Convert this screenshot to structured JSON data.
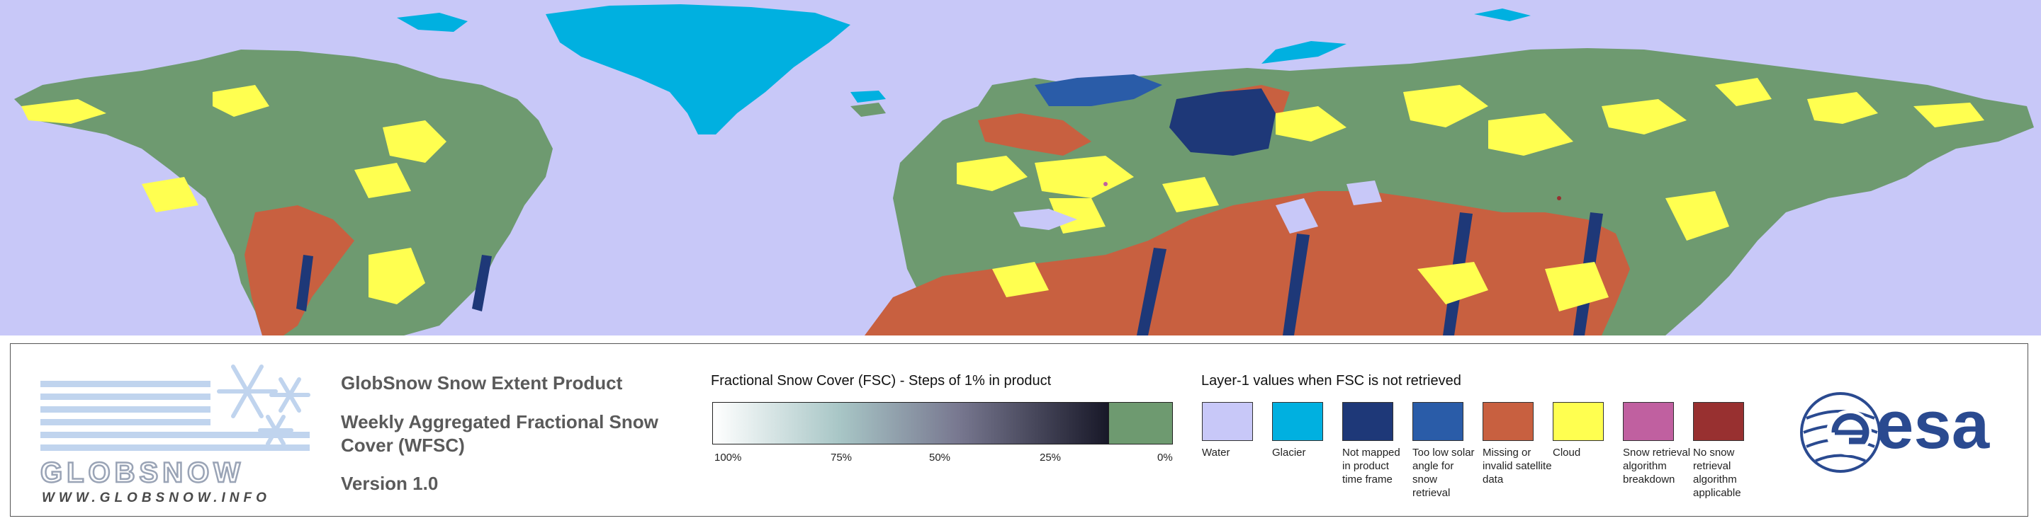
{
  "product": {
    "title_line1": "GlobSnow Snow Extent Product",
    "title_line2": "Weekly Aggregated Fractional Snow Cover (WFSC)",
    "version": "Version 1.0"
  },
  "logo": {
    "word": "GLOBSNOW",
    "url": "WWW.GLOBSNOW.INFO"
  },
  "fsc_scale": {
    "title": "Fractional Snow Cover (FSC) - Steps of 1% in product",
    "ticks": [
      "100%",
      "75%",
      "50%",
      "25%",
      "0%"
    ],
    "colors": {
      "high": "#ffffff",
      "mid": "#787890",
      "low": "#181828",
      "no_snow": "#6e9a70"
    }
  },
  "layer1": {
    "title": "Layer-1 values when FSC is not retrieved",
    "classes": [
      {
        "label": "Water",
        "color": "#c8c8f8"
      },
      {
        "label": "Glacier",
        "color": "#00b0e0"
      },
      {
        "label": "Not mapped in product time frame",
        "color": "#1e3878"
      },
      {
        "label": "Too low solar angle for snow retrieval",
        "color": "#2a5ca8"
      },
      {
        "label": "Missing or invalid satellite data",
        "color": "#c86040"
      },
      {
        "label": "Cloud",
        "color": "#ffff50"
      },
      {
        "label": "Snow retrieval algorithm breakdown",
        "color": "#c060a0"
      },
      {
        "label": "No snow retrieval algorithm applicable",
        "color": "#983030"
      }
    ]
  },
  "esa": {
    "word": "esa"
  }
}
